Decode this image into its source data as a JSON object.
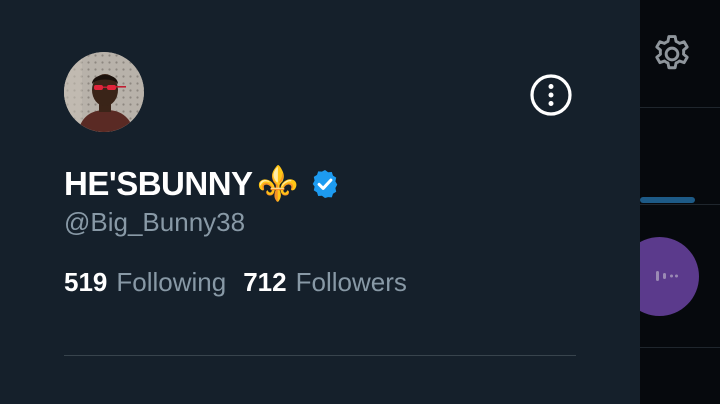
{
  "profile": {
    "display_name": "HE'SBUNNY",
    "name_emoji": "⚜️",
    "verified": true,
    "handle": "@Big_Bunny38",
    "avatar": "avatar-photo"
  },
  "stats": {
    "following_count": "519",
    "following_label": "Following",
    "followers_count": "712",
    "followers_label": "Followers"
  },
  "icons": {
    "more": "more-vertical-circle-icon",
    "verified": "verified-badge-icon",
    "settings": "gear-icon"
  },
  "colors": {
    "background": "#15202b",
    "text_primary": "#ffffff",
    "text_secondary": "#8899a6",
    "verified_blue": "#1d9bf0",
    "divider": "#38444d"
  }
}
